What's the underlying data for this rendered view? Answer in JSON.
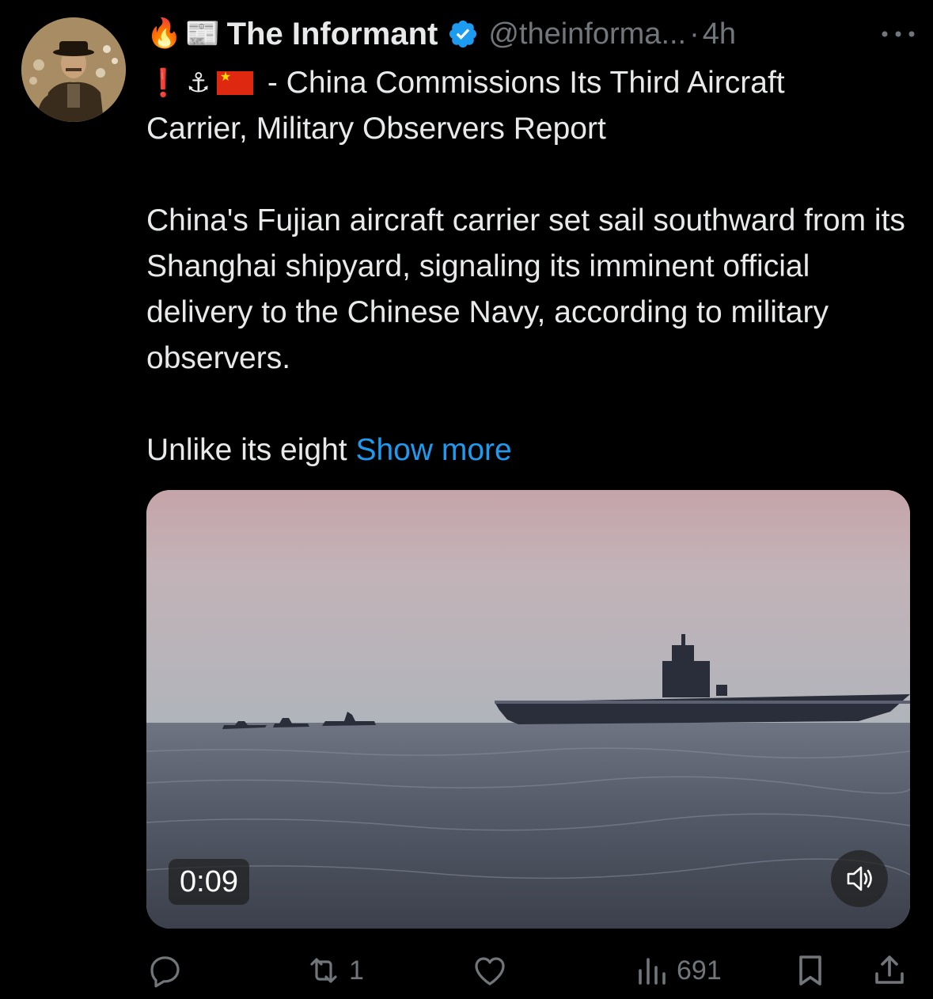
{
  "author": {
    "emoji_prefix": [
      "🔥",
      "📰"
    ],
    "display_name": "The Informant",
    "handle": "@theinforma...",
    "separator": "·",
    "time": "4h"
  },
  "post": {
    "line1_emojis": [
      "❗",
      "⚓"
    ],
    "headline_line1": "- China Commissions Its Third Aircraft",
    "headline_line2": "Carrier, Military Observers Report",
    "paragraph": "China's Fujian aircraft carrier set sail southward from its Shanghai shipyard, signaling its imminent official delivery to the Chinese Navy, according to military observers.",
    "teaser": "Unlike its eight ",
    "show_more": "Show more"
  },
  "media": {
    "timecode": "0:09"
  },
  "actions": {
    "retweets": "1",
    "views": "691"
  },
  "colors": {
    "background": "#000000",
    "text": "#e7e9ea",
    "muted": "#71767b",
    "link": "#1d9bf0",
    "verified": "#1d9bf0"
  },
  "icons": [
    "more-icon",
    "verified-badge-icon",
    "reply-icon",
    "retweet-icon",
    "like-icon",
    "views-icon",
    "bookmark-icon",
    "share-icon",
    "volume-icon"
  ]
}
